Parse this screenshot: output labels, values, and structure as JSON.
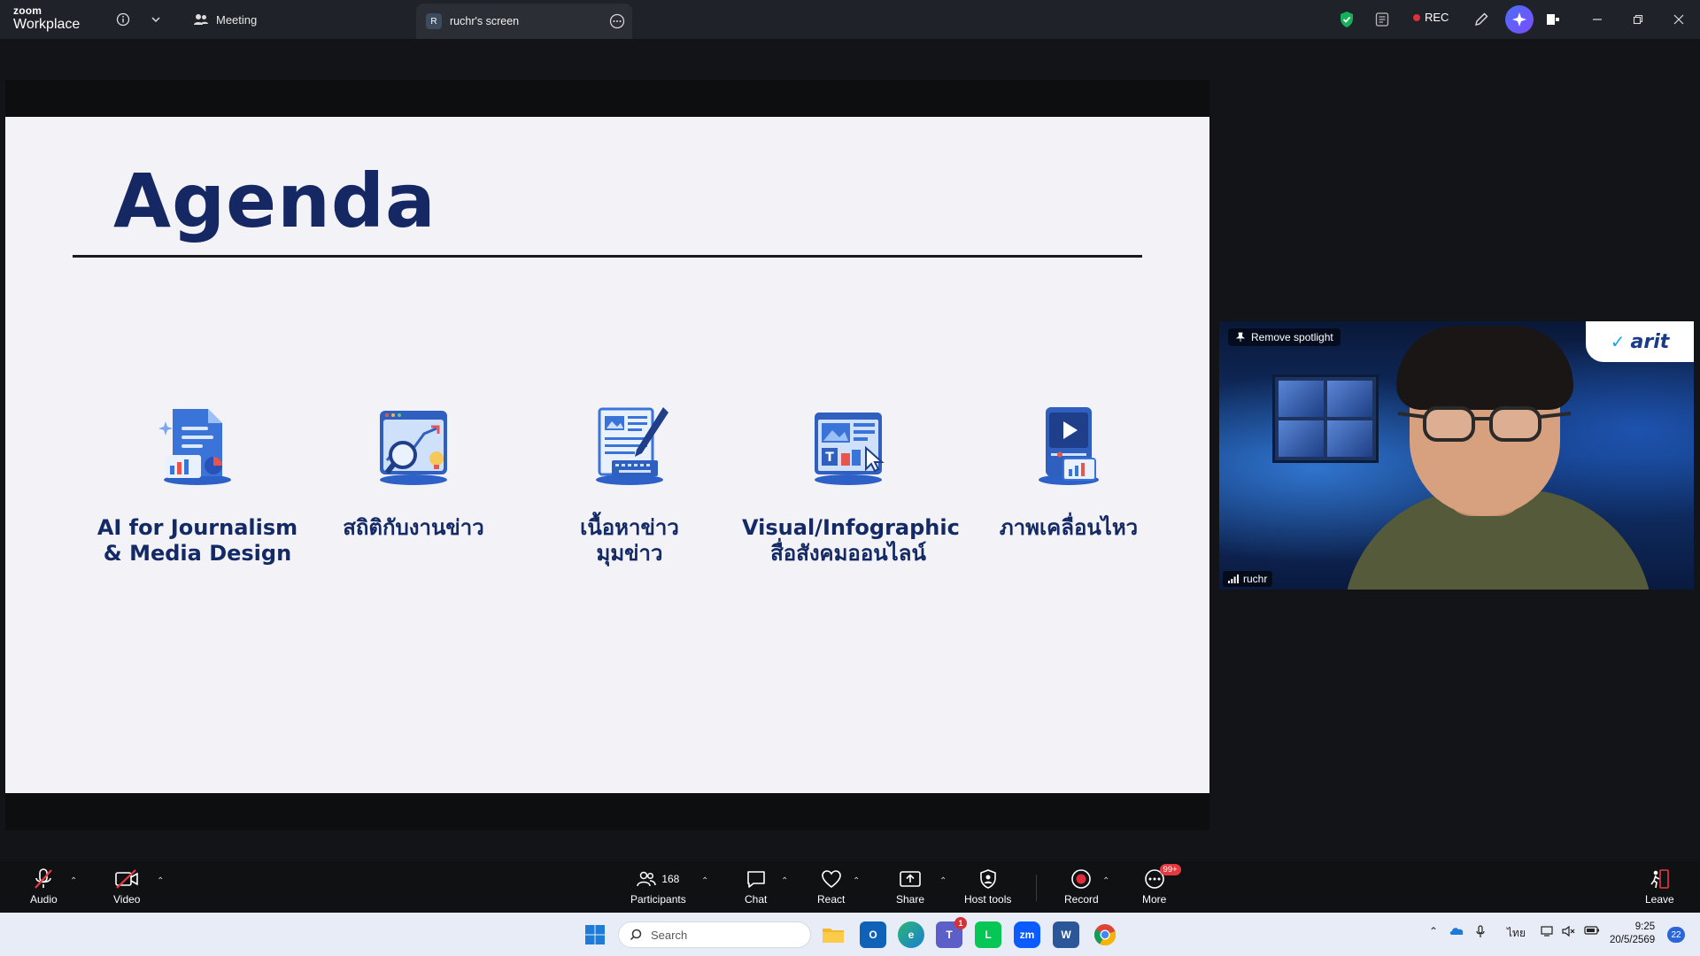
{
  "app": {
    "logo_top": "zoom",
    "logo_bottom": "Workplace"
  },
  "tabs": {
    "meeting": "Meeting",
    "screen_share": "ruchr's screen",
    "screen_share_initial": "R"
  },
  "titlebar": {
    "rec_label": "REC"
  },
  "slide": {
    "title": "Agenda",
    "items": [
      {
        "line1": "AI for Journalism",
        "line2": "& Media Design",
        "icon": "document-chart-icon"
      },
      {
        "line1": "สถิติกับงานข่าว",
        "line2": "",
        "icon": "analytics-magnifier-icon"
      },
      {
        "line1": "เนื้อหาข่าว",
        "line2": "มุมข่าว",
        "icon": "news-writing-icon"
      },
      {
        "line1": "Visual/Infographic",
        "line2": "สื่อสังคมออนไลน์",
        "icon": "infographic-screen-icon"
      },
      {
        "line1": "ภาพเคลื่อนไหว",
        "line2": "",
        "icon": "video-play-icon"
      }
    ]
  },
  "video": {
    "remove_spotlight": "Remove spotlight",
    "participant_name": "ruchr",
    "brand_text": "arit"
  },
  "controls": {
    "audio": "Audio",
    "video": "Video",
    "participants": "Participants",
    "participant_count": "168",
    "chat": "Chat",
    "react": "React",
    "share": "Share",
    "host_tools": "Host tools",
    "record": "Record",
    "more": "More",
    "more_badge": "99+",
    "leave": "Leave"
  },
  "taskbar": {
    "search_placeholder": "Search",
    "teams_badge": "1",
    "language": "ไทย",
    "time": "9:25",
    "date": "20/5/2569",
    "notification_count": "22"
  },
  "colors": {
    "slide_title": "#152864",
    "record_red": "#e02d3c",
    "shield_green": "#16b05b"
  }
}
